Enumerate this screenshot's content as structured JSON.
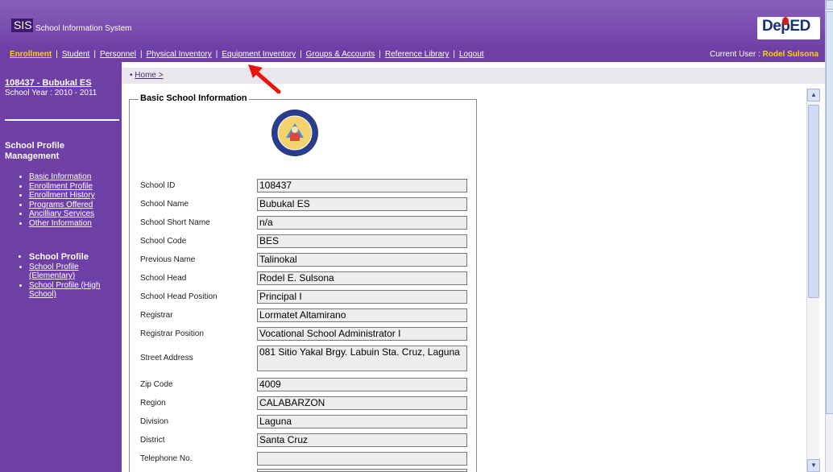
{
  "header": {
    "logo": "SIS",
    "app_name": "School Information System",
    "brand": "DepED"
  },
  "nav": {
    "items": [
      {
        "label": "Enrollment",
        "active": true
      },
      {
        "label": "Student"
      },
      {
        "label": "Personnel"
      },
      {
        "label": "Physical Inventory"
      },
      {
        "label": "Equipment Inventory"
      },
      {
        "label": "Groups & Accounts"
      },
      {
        "label": "Reference Library"
      },
      {
        "label": "Logout"
      }
    ],
    "current_user_label": "Current User : ",
    "current_user": "Rodel Sulsona"
  },
  "sidebar": {
    "school": "108437 - Bubukal ES",
    "school_year": "School Year : 2010 - 2011",
    "section_title": "School Profile Management",
    "items": [
      "Basic Information",
      "Enrollment Profile",
      "Enrollment History",
      "Programs Offered",
      "Ancilliary Services",
      "Other Information"
    ],
    "profile_head": "School Profile",
    "profile_items": [
      "School Profile (Elementary)",
      "School Profile (High School)"
    ]
  },
  "breadcrumb": "Home >",
  "form": {
    "legend": "Basic School Information",
    "fields": [
      {
        "label": "School ID",
        "value": "108437"
      },
      {
        "label": "School Name",
        "value": "Bubukal ES"
      },
      {
        "label": "School Short Name",
        "value": "n/a"
      },
      {
        "label": "School Code",
        "value": "BES"
      },
      {
        "label": "Previous Name",
        "value": "Talinokal"
      },
      {
        "label": "School Head",
        "value": "Rodel E. Sulsona"
      },
      {
        "label": "School Head Position",
        "value": "Principal I"
      },
      {
        "label": "Registrar",
        "value": "Lormatet Altamirano"
      },
      {
        "label": "Registrar Position",
        "value": "Vocational School Administrator I"
      },
      {
        "label": "Street Address",
        "value": "081 Sitio Yakal Brgy. Labuin Sta. Cruz, Laguna"
      },
      {
        "label": "Zip Code",
        "value": "4009"
      },
      {
        "label": "Region",
        "value": "CALABARZON"
      },
      {
        "label": "Division",
        "value": "Laguna"
      },
      {
        "label": "District",
        "value": "Santa Cruz"
      },
      {
        "label": "Telephone No.",
        "value": ""
      }
    ]
  },
  "colors": {
    "header_purple": "#6e3fa5",
    "active_nav": "#ffd200",
    "arrow": "#e8150b"
  }
}
